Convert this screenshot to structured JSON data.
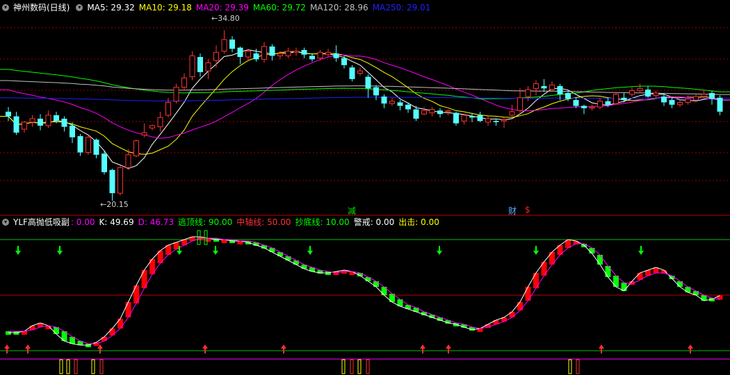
{
  "main_panel": {
    "control_icon": "chevron-down-icon",
    "title": "神州数码(日线)",
    "ma": [
      {
        "label": "MA5: 29.32",
        "color": "#ffffff"
      },
      {
        "label": "MA10: 29.18",
        "color": "#ffff00"
      },
      {
        "label": "MA20: 29.39",
        "color": "#ff00ff"
      },
      {
        "label": "MA60: 29.72",
        "color": "#00ff00"
      },
      {
        "label": "MA120: 28.96",
        "color": "#c0c0c0"
      },
      {
        "label": "MA250: 29.01",
        "color": "#0000ff"
      }
    ],
    "high_label": "34.80",
    "low_label": "20.15",
    "marker_jian": "减",
    "marker_cai": "财",
    "marker_dollar": "$"
  },
  "indicator_panel": {
    "title": "YLF高抛低吸副",
    "value": ": 0.00",
    "k": "K: 49.69",
    "d": "D: 46.73",
    "escape": "逃顶线: 90.00",
    "middle": "中轴线: 50.00",
    "bottom": "抄底线: 10.00",
    "alert": "警戒: 0.00",
    "attack": "出击: 0.00"
  },
  "colors": {
    "up": "#ff3232",
    "down": "#54ffff",
    "grid": "#a00000",
    "border": "#c00000",
    "ind_up": "#ff0000",
    "ind_down": "#00ff00",
    "k_line": "#ff00ff",
    "d_line": "#ffffff"
  },
  "chart_data": {
    "type": "candlestick",
    "candles": [
      [
        27.8,
        27.4,
        28.2,
        27.0
      ],
      [
        27.4,
        26.0,
        27.8,
        25.8
      ],
      [
        26.3,
        26.9,
        27.0,
        26.0
      ],
      [
        26.9,
        27.2,
        27.5,
        26.5
      ],
      [
        27.2,
        26.6,
        27.6,
        26.2
      ],
      [
        26.6,
        27.5,
        27.9,
        26.4
      ],
      [
        27.5,
        27.0,
        27.8,
        26.8
      ],
      [
        27.2,
        26.5,
        27.4,
        26.1
      ],
      [
        26.6,
        25.6,
        26.9,
        25.1
      ],
      [
        25.7,
        24.3,
        25.9,
        24.0
      ],
      [
        24.3,
        25.6,
        25.8,
        24.1
      ],
      [
        25.4,
        24.1,
        25.5,
        23.8
      ],
      [
        24.2,
        22.6,
        24.5,
        22.4
      ],
      [
        22.8,
        20.8,
        22.9,
        20.15
      ],
      [
        20.8,
        23.0,
        23.2,
        20.6
      ],
      [
        23.0,
        24.1,
        24.6,
        22.8
      ],
      [
        24.0,
        25.3,
        25.4,
        23.9
      ],
      [
        25.8,
        26.0,
        26.8,
        25.6
      ],
      [
        26.4,
        26.6,
        26.7,
        26.2
      ],
      [
        26.5,
        27.3,
        27.8,
        26.1
      ],
      [
        27.5,
        28.6,
        29.0,
        27.3
      ],
      [
        28.7,
        29.9,
        30.2,
        28.5
      ],
      [
        29.9,
        30.7,
        31.1,
        29.6
      ],
      [
        30.8,
        32.6,
        33.0,
        30.5
      ],
      [
        32.5,
        31.2,
        32.8,
        30.8
      ],
      [
        31.3,
        32.0,
        32.3,
        30.6
      ],
      [
        32.2,
        32.9,
        33.5,
        31.6
      ],
      [
        33.0,
        34.0,
        34.8,
        32.8
      ],
      [
        34.0,
        33.2,
        34.3,
        32.9
      ],
      [
        33.3,
        32.5,
        33.4,
        31.9
      ],
      [
        32.5,
        33.0,
        33.2,
        32.1
      ],
      [
        32.8,
        32.3,
        33.2,
        32.1
      ],
      [
        32.3,
        33.4,
        33.8,
        32.0
      ],
      [
        33.4,
        32.6,
        33.6,
        32.2
      ],
      [
        32.6,
        32.8,
        33.0,
        32.3
      ],
      [
        32.6,
        33.0,
        33.3,
        32.4
      ],
      [
        32.9,
        33.0,
        33.3,
        32.6
      ],
      [
        33.1,
        32.7,
        33.3,
        32.4
      ],
      [
        32.6,
        32.3,
        32.8,
        32.1
      ],
      [
        32.4,
        32.9,
        33.1,
        32.2
      ],
      [
        32.7,
        32.9,
        33.2,
        32.5
      ],
      [
        32.8,
        32.4,
        33.5,
        32.1
      ],
      [
        32.4,
        31.8,
        32.6,
        31.5
      ],
      [
        31.6,
        30.6,
        31.8,
        30.4
      ],
      [
        31.1,
        31.3,
        31.6,
        30.9
      ],
      [
        30.8,
        29.8,
        31.0,
        29.0
      ],
      [
        29.9,
        29.2,
        30.1,
        28.8
      ],
      [
        29.1,
        28.5,
        29.3,
        28.1
      ],
      [
        28.5,
        28.7,
        29.0,
        28.3
      ],
      [
        28.6,
        28.3,
        28.8,
        27.9
      ],
      [
        28.4,
        28.0,
        28.6,
        27.7
      ],
      [
        28.0,
        27.2,
        28.3,
        27.0
      ],
      [
        27.6,
        27.9,
        28.2,
        27.5
      ],
      [
        27.7,
        28.0,
        28.2,
        27.4
      ],
      [
        27.9,
        27.6,
        28.1,
        27.3
      ],
      [
        27.8,
        27.9,
        28.0,
        27.5
      ],
      [
        27.7,
        26.8,
        27.8,
        26.6
      ],
      [
        27.0,
        27.5,
        27.6,
        26.7
      ],
      [
        27.4,
        27.3,
        27.7,
        26.9
      ],
      [
        27.5,
        27.0,
        27.8,
        26.9
      ],
      [
        26.9,
        27.2,
        27.4,
        26.6
      ],
      [
        27.0,
        26.9,
        27.2,
        26.6
      ],
      [
        27.0,
        27.1,
        27.3,
        26.4
      ],
      [
        27.5,
        27.8,
        28.4,
        27.3
      ],
      [
        27.9,
        29.0,
        29.8,
        27.6
      ],
      [
        29.1,
        29.7,
        30.0,
        28.7
      ],
      [
        29.8,
        30.2,
        30.5,
        29.2
      ],
      [
        30.0,
        29.8,
        30.6,
        29.5
      ],
      [
        29.7,
        30.1,
        30.4,
        29.6
      ],
      [
        30.0,
        29.3,
        30.2,
        28.8
      ],
      [
        29.4,
        28.9,
        29.6,
        28.7
      ],
      [
        28.8,
        28.3,
        29.0,
        28.1
      ],
      [
        28.3,
        28.1,
        28.4,
        27.6
      ],
      [
        28.1,
        28.2,
        28.4,
        27.9
      ],
      [
        28.2,
        28.7,
        29.0,
        28.0
      ],
      [
        28.7,
        28.4,
        29.0,
        28.2
      ],
      [
        28.5,
        29.3,
        29.5,
        28.4
      ],
      [
        29.0,
        28.8,
        29.4,
        28.6
      ],
      [
        29.3,
        29.6,
        29.9,
        29.1
      ],
      [
        29.6,
        29.8,
        30.2,
        29.4
      ],
      [
        29.7,
        29.1,
        30.0,
        29.0
      ],
      [
        29.2,
        29.4,
        29.6,
        28.9
      ],
      [
        29.1,
        28.6,
        29.4,
        28.3
      ],
      [
        28.8,
        28.4,
        29.0,
        28.1
      ],
      [
        28.4,
        28.6,
        28.9,
        28.2
      ],
      [
        28.6,
        28.9,
        29.2,
        28.4
      ],
      [
        28.8,
        29.1,
        29.3,
        28.6
      ],
      [
        29.1,
        29.3,
        29.6,
        28.9
      ],
      [
        29.4,
        28.9,
        29.6,
        28.4
      ],
      [
        29.0,
        27.8,
        29.2,
        27.5
      ]
    ],
    "ma_series": [
      "MA5",
      "MA10",
      "MA20",
      "MA60",
      "MA120",
      "MA250"
    ],
    "price_range": [
      19.5,
      36.2
    ],
    "indicator": {
      "k": [
        23,
        23,
        24,
        28,
        30,
        28,
        22,
        17,
        15,
        14,
        14,
        16,
        20,
        26,
        33,
        45,
        57,
        68,
        76,
        82,
        86,
        88,
        90,
        92,
        92,
        91,
        90,
        90,
        89,
        89,
        88,
        86,
        84,
        81,
        78,
        75,
        72,
        69,
        67,
        66,
        66,
        67,
        68,
        67,
        64,
        60,
        56,
        50,
        45,
        42,
        40,
        38,
        36,
        34,
        32,
        30,
        29,
        27,
        25,
        26,
        29,
        32,
        34,
        38,
        45,
        56,
        66,
        74,
        81,
        86,
        90,
        89,
        86,
        80,
        72,
        63,
        56,
        53,
        60,
        66,
        68,
        70,
        68,
        62,
        56,
        52,
        50,
        46,
        47,
        49.69
      ],
      "d": [
        24,
        24,
        24,
        25,
        27,
        28,
        27,
        24,
        20,
        17,
        15,
        15,
        17,
        21,
        26,
        34,
        44,
        55,
        65,
        73,
        79,
        83,
        86,
        89,
        91,
        91,
        91,
        90,
        90,
        89,
        89,
        88,
        86,
        84,
        81,
        78,
        75,
        72,
        70,
        68,
        67,
        66,
        67,
        67,
        66,
        63,
        60,
        56,
        51,
        47,
        43,
        41,
        38,
        36,
        34,
        32,
        30,
        29,
        27,
        26,
        27,
        29,
        31,
        34,
        39,
        46,
        55,
        64,
        72,
        79,
        84,
        87,
        87,
        84,
        79,
        71,
        64,
        59,
        58,
        61,
        64,
        66,
        66,
        64,
        60,
        56,
        53,
        50,
        48,
        46.73
      ],
      "escape_line": 90,
      "middle_line": 50,
      "bottom_line": 10
    }
  }
}
